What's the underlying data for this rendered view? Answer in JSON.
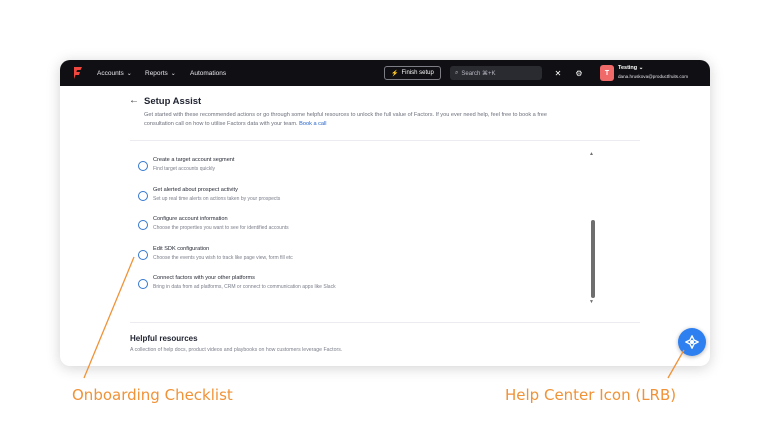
{
  "nav": {
    "items": [
      {
        "label": "Accounts",
        "chevron": true
      },
      {
        "label": "Reports",
        "chevron": true
      },
      {
        "label": "Automations",
        "chevron": false
      }
    ],
    "finish_setup": "Finish setup",
    "search_placeholder": "Search ⌘+K",
    "user": {
      "initial": "T",
      "name": "Testing",
      "email": "dana.hruskova@productfruits.com"
    }
  },
  "setup": {
    "title": "Setup Assist",
    "description": "Get started with these recommended actions or go through some helpful resources to unlock the full value of Factors. If you ever need help, feel free to book a free consultation call on how to utilise Factors data with your team.",
    "book_call": "Book a call"
  },
  "tasks": [
    {
      "title": "Create a target account segment",
      "subtitle": "Find target accounts quickly"
    },
    {
      "title": "Get alerted about prospect activity",
      "subtitle": "Set up real time alerts on actions taken by your prospects"
    },
    {
      "title": "Configure account information",
      "subtitle": "Choose the properties you want to see for identified accounts"
    },
    {
      "title": "Edit SDK configuration",
      "subtitle": "Choose the events you wish to track like page view, form fill etc"
    },
    {
      "title": "Connect factors with your other platforms",
      "subtitle": "Bring in data from ad platforms, CRM or connect to communication apps like Slack"
    }
  ],
  "helpful": {
    "title": "Helpful resources",
    "description": "A collection of help docs, product videos and playbooks on how customers leverage Factors."
  },
  "annotations": {
    "checklist": "Onboarding Checklist",
    "help_center": "Help Center Icon (LRB)"
  },
  "colors": {
    "accent": "#2e7ff0",
    "annotation": "#f09237",
    "nav_bg": "#101014",
    "logo": "#f0483e"
  }
}
